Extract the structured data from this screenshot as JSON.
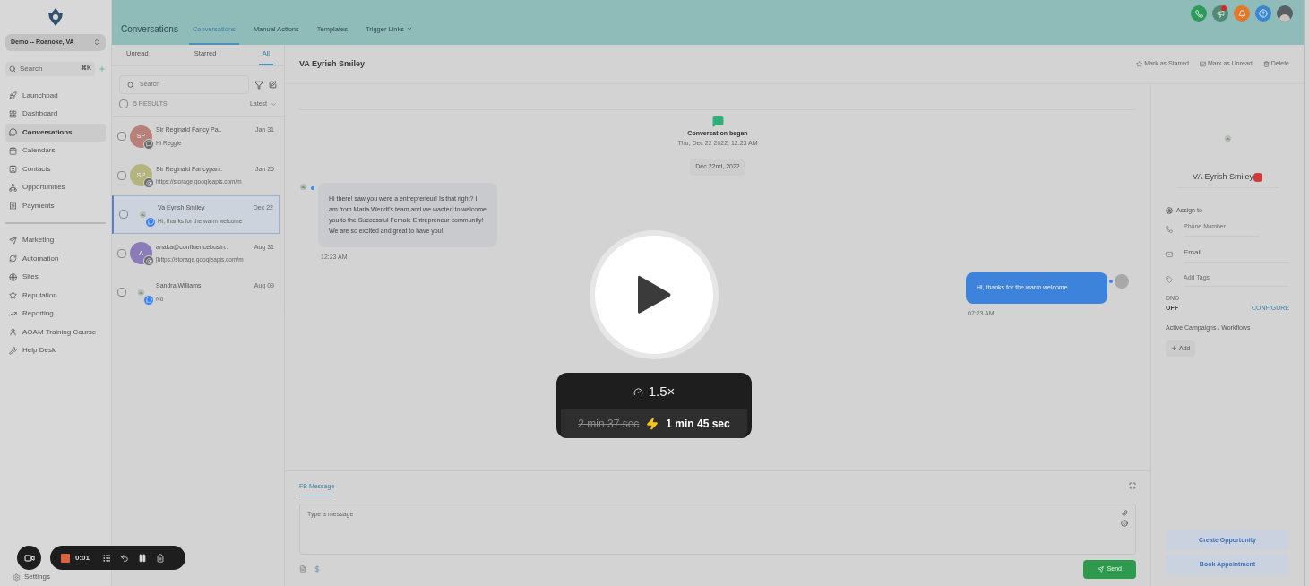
{
  "sidebar": {
    "location": "Demo -- Roanoke, VA",
    "search": {
      "placeholder": "Search",
      "shortcut": "⌘K"
    },
    "groups": [
      [
        {
          "label": "Launchpad",
          "selected": false
        },
        {
          "label": "Dashboard",
          "selected": false
        },
        {
          "label": "Conversations",
          "selected": true
        },
        {
          "label": "Calendars",
          "selected": false
        },
        {
          "label": "Contacts",
          "selected": false
        },
        {
          "label": "Opportunities",
          "selected": false
        },
        {
          "label": "Payments",
          "selected": false
        }
      ],
      [
        {
          "label": "Marketing",
          "selected": false
        },
        {
          "label": "Automation",
          "selected": false
        },
        {
          "label": "Sites",
          "selected": false
        },
        {
          "label": "Reputation",
          "selected": false
        },
        {
          "label": "Reporting",
          "selected": false
        },
        {
          "label": "AOAM Training Course",
          "selected": false
        },
        {
          "label": "Help Desk",
          "selected": false
        }
      ]
    ],
    "settings": "Settings"
  },
  "topbar": {
    "title": "Conversations",
    "tabs": [
      {
        "label": "Conversations",
        "selected": true,
        "dropdown": false
      },
      {
        "label": "Manual Actions",
        "selected": false,
        "dropdown": false
      },
      {
        "label": "Templates",
        "selected": false,
        "dropdown": false
      },
      {
        "label": "Trigger Links",
        "selected": false,
        "dropdown": true
      }
    ]
  },
  "list": {
    "filters": [
      {
        "label": "Unread",
        "selected": false
      },
      {
        "label": "Starred",
        "selected": false
      },
      {
        "label": "All",
        "selected": true
      }
    ],
    "search": {
      "placeholder": "Search"
    },
    "all_checked": false,
    "results": "5 RESULTS",
    "sort": "Latest",
    "conversations": [
      {
        "kind": "initials",
        "initials": "SP",
        "color": "#b88078",
        "name": "Sir Reginald Fancy Pa..",
        "preview": "Hi Reggie",
        "date": "Jan 31",
        "selected": false,
        "checked": false
      },
      {
        "kind": "initials",
        "initials": "SP",
        "color": "#b4b47e",
        "name": "Sir Reginald Fancypan..",
        "preview": "https://storage.googleapis.com/m",
        "date": "Jan 26",
        "selected": false,
        "checked": false
      },
      {
        "kind": "image",
        "name": "Va Eyrish Smiley",
        "preview": "Hi, thanks for the warm welcome",
        "date": "Dec 22",
        "selected": true,
        "checked": false
      },
      {
        "kind": "initials",
        "initials": "A",
        "color": "#8b7bb8",
        "name": "anaka@confluencebusin..",
        "preview": "[https://storage.googleapis.com/m",
        "date": "Aug 31",
        "selected": false,
        "checked": false
      },
      {
        "kind": "image",
        "name": "Sandra Williams",
        "preview": "No",
        "date": "Aug 09",
        "selected": false,
        "checked": false
      }
    ]
  },
  "chat": {
    "contact": "VA Eyrish Smiley",
    "actions": [
      "Mark as Starred",
      "Mark as Unread",
      "Delete"
    ],
    "event": {
      "title": "Conversation began",
      "time": "Thu, Dec 22 2022, 12:23 AM"
    },
    "date_chip": "Dec 22nd, 2022",
    "messages": [
      {
        "kind": "inbound",
        "text": "Hi there! saw you were a entrepreneur! Is that right? I am from Maria Wendt's team and we wanted to welcome you to the Successful Female Entrepreneur community! We are so excited and great to have you!",
        "time": "12:23 AM"
      },
      {
        "kind": "outbound",
        "text": "Hi, thanks for the warm welcome",
        "time": "07:23 AM"
      }
    ],
    "composer": {
      "tab": "FB Message",
      "placeholder": "Type a message",
      "send": "Send"
    }
  },
  "contact": {
    "name": "VA Eyrish Smiley",
    "assign": "Assign to",
    "phone": {
      "placeholder": "Phone Number"
    },
    "email": {
      "placeholder": "Email"
    },
    "tags": {
      "placeholder": "Add Tags"
    },
    "dnd_label": "DND",
    "dnd_value": "OFF",
    "configure": "CONFIGURE",
    "campaigns": "Active Campaigns / Workflows",
    "add": "Add",
    "buttons": [
      "Create Opportunity",
      "Book Appointment"
    ]
  },
  "player": {
    "speed": "1.5×",
    "original": "2 min 37 sec",
    "fast": "1 min 45 sec",
    "recording_time": "0:01"
  }
}
